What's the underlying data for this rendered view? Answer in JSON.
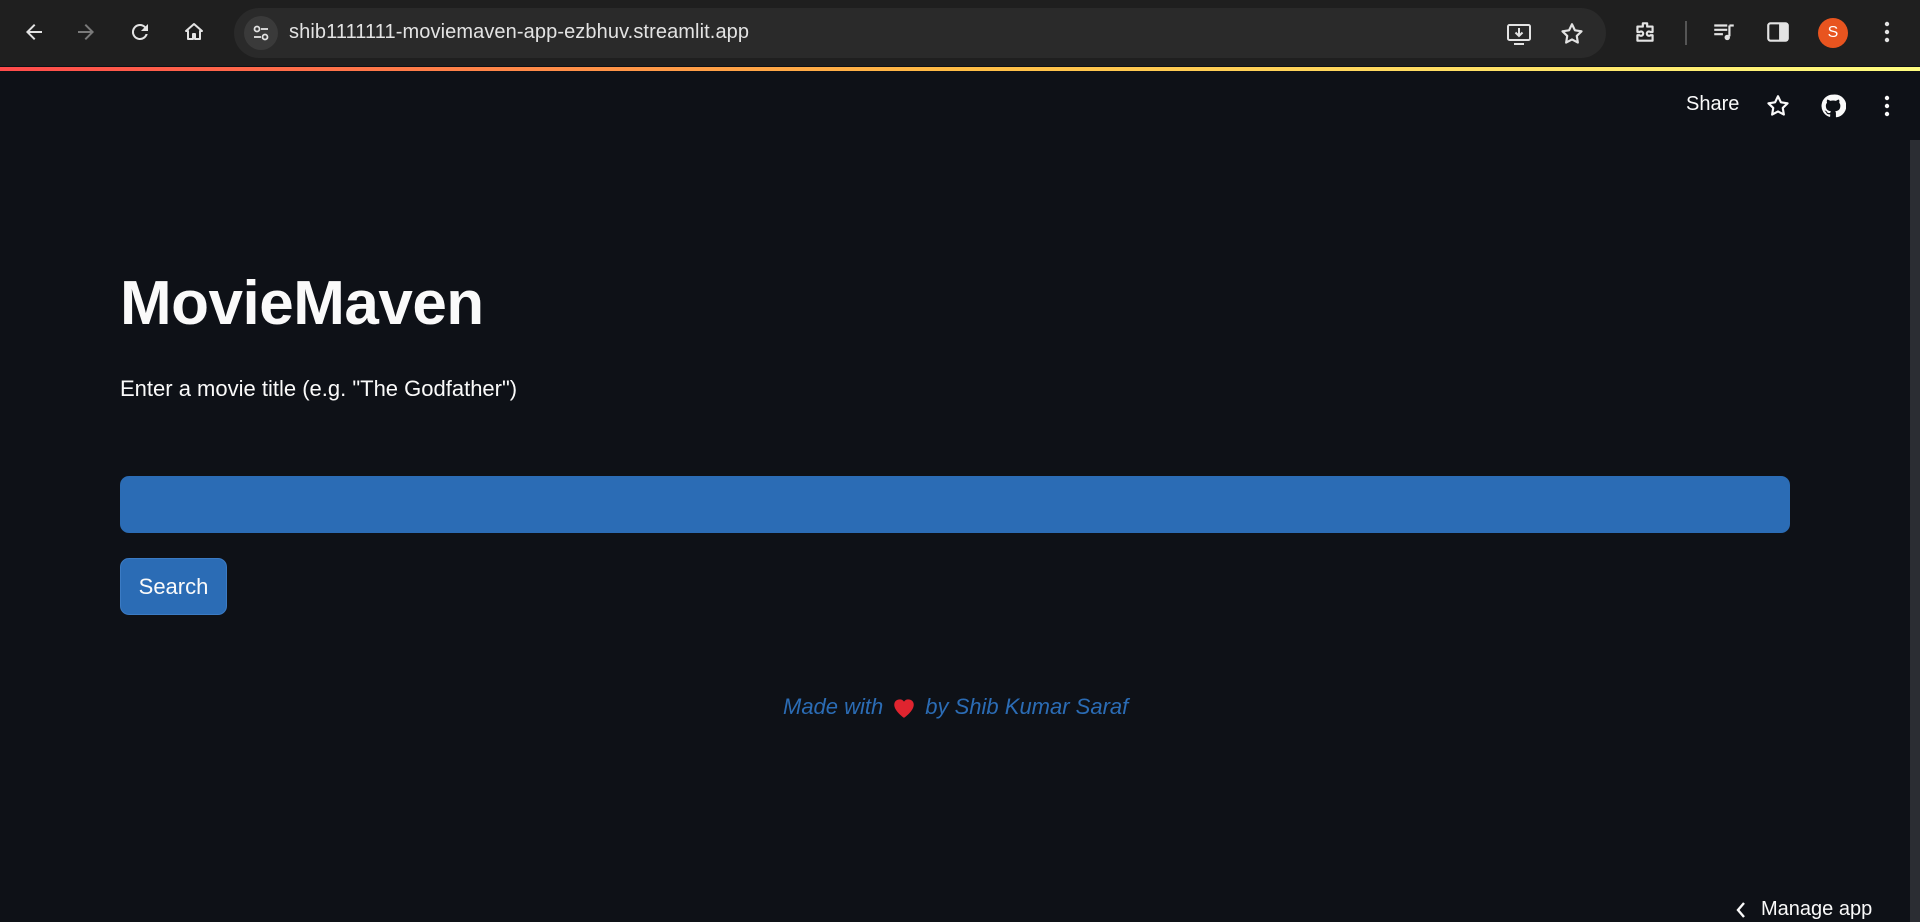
{
  "browser": {
    "url": "shib1111111-moviemaven-app-ezbhuv.streamlit.app",
    "avatar_letter": "S"
  },
  "header": {
    "share_label": "Share"
  },
  "main": {
    "title": "MovieMaven",
    "prompt": "Enter a movie title (e.g. \"The Godfather\")",
    "search_value": "",
    "search_button_label": "Search",
    "footer_prefix": "Made with",
    "footer_suffix": "by Shib Kumar Saraf"
  },
  "bottom": {
    "manage_label": "Manage app"
  },
  "colors": {
    "background": "#0e1117",
    "accent_blue": "#2b6cb5",
    "heart_red": "#e0242f",
    "avatar": "#e8541f"
  }
}
